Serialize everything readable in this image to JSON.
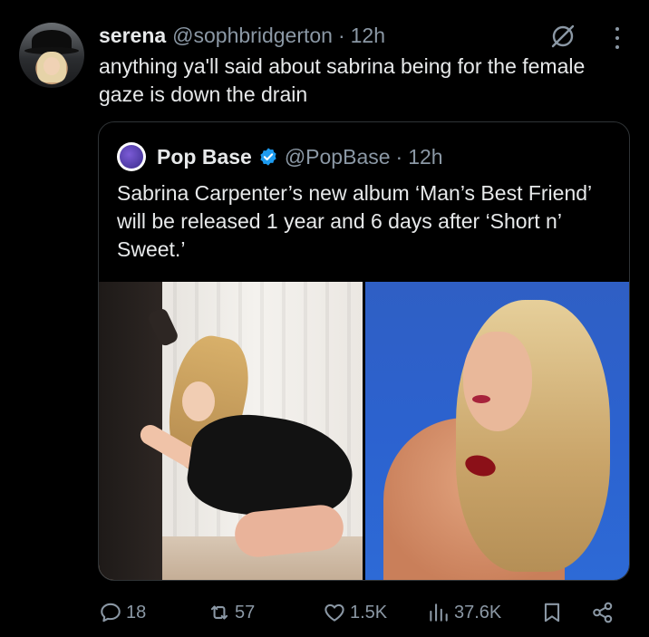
{
  "tweet": {
    "author_name": "serena",
    "author_handle": "@sophbridgerton",
    "separator": "·",
    "time": "12h",
    "text": "anything ya'll said about sabrina being for the female gaze is down the drain"
  },
  "quoted": {
    "author_name": "Pop Base",
    "author_handle": "@PopBase",
    "separator": "·",
    "time": "12h",
    "text": "Sabrina Carpenter’s new album ‘Man’s Best Friend’ will be released 1 year and 6 days after ‘Short n’ Sweet.’"
  },
  "actions": {
    "replies": "18",
    "retweets": "57",
    "likes": "1.5K",
    "views": "37.6K"
  },
  "icons": {
    "grok": "grok-icon",
    "more": "more-icon",
    "verified": "verified-badge-icon",
    "reply": "reply-icon",
    "retweet": "retweet-icon",
    "like": "heart-icon",
    "views": "views-icon",
    "bookmark": "bookmark-icon",
    "share": "share-icon"
  },
  "colors": {
    "background": "#000000",
    "text": "#e7e9ea",
    "secondary": "#8b98a5",
    "verified": "#1d9bf0",
    "border": "#2f3336"
  }
}
